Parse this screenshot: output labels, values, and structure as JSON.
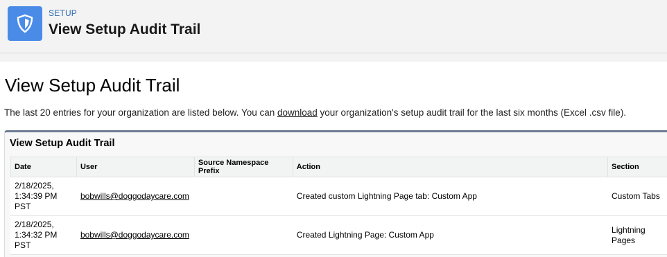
{
  "header": {
    "eyebrow": "SETUP",
    "title": "View Setup Audit Trail",
    "icon": "shield-icon",
    "icon_color": "#4a8be8"
  },
  "page": {
    "heading": "View Setup Audit Trail",
    "intro_before": "The last 20 entries for your organization are listed below. You can ",
    "intro_link": "download",
    "intro_after": " your organization's setup audit trail for the last six months (Excel .csv file)."
  },
  "panel": {
    "title": "View Setup Audit Trail",
    "accent_color": "#6e7b93"
  },
  "table": {
    "columns": [
      "Date",
      "User",
      "Source Namespace Prefix",
      "Action",
      "Section"
    ],
    "rows": [
      {
        "date": "2/18/2025, 1:34:39 PM PST",
        "user": "bobwills@doggodaycare.com",
        "prefix": "",
        "action": "Created custom Lightning Page tab: Custom App",
        "section": "Custom Tabs"
      },
      {
        "date": "2/18/2025, 1:34:32 PM PST",
        "user": "bobwills@doggodaycare.com",
        "prefix": "",
        "action": "Created Lightning Page: Custom App",
        "section": "Lightning Pages"
      }
    ]
  }
}
